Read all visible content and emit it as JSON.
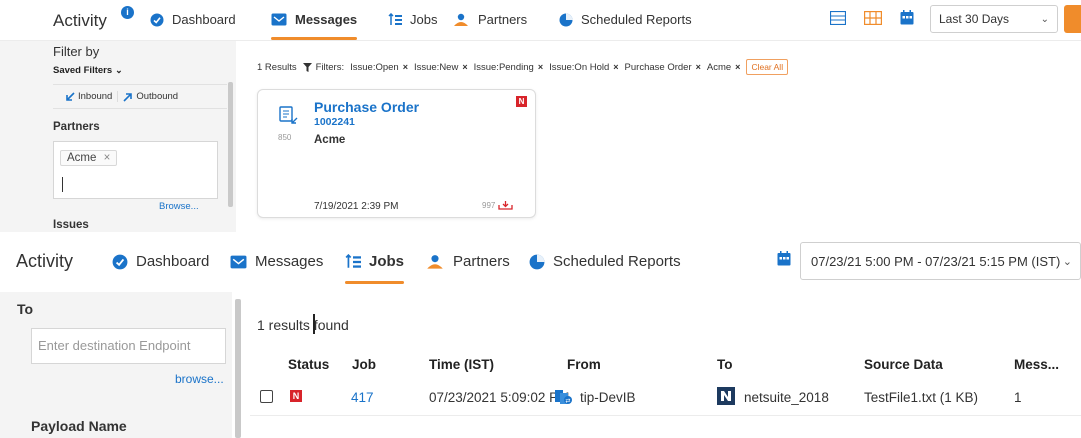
{
  "panel1": {
    "nav": {
      "title": "Activity",
      "title_badge": "i",
      "items": [
        {
          "label": "Dashboard",
          "icon": "dashboard-icon"
        },
        {
          "label": "Messages",
          "icon": "messages-icon",
          "active": true
        },
        {
          "label": "Jobs",
          "icon": "jobs-icon"
        },
        {
          "label": "Partners",
          "icon": "partners-icon"
        },
        {
          "label": "Scheduled Reports",
          "icon": "scheduled-reports-icon"
        }
      ],
      "date_range": "Last 30 Days",
      "accent": "#f08c2b"
    },
    "sidebar": {
      "filter_by": "Filter by",
      "saved_filters": "Saved Filters",
      "inbound": "Inbound",
      "outbound": "Outbound",
      "partners_heading": "Partners",
      "partner_tag": "Acme",
      "browse": "Browse...",
      "issues_heading": "Issues"
    },
    "results": {
      "count_text": "1 Results",
      "filters_label": "Filters:",
      "chips": [
        "Issue:Open",
        "Issue:New",
        "Issue:Pending",
        "Issue:On Hold",
        "Purchase Order",
        "Acme"
      ],
      "clear_all": "Clear All"
    },
    "card": {
      "title": "Purchase Order",
      "number": "1002241",
      "doc_code": "850",
      "partner": "Acme",
      "date": "7/19/2021 2:39 PM",
      "ack_code": "997",
      "badge": "N"
    }
  },
  "panel2": {
    "nav": {
      "title": "Activity",
      "items": [
        {
          "label": "Dashboard",
          "icon": "dashboard-icon"
        },
        {
          "label": "Messages",
          "icon": "messages-icon"
        },
        {
          "label": "Jobs",
          "icon": "jobs-icon",
          "active": true
        },
        {
          "label": "Partners",
          "icon": "partners-icon"
        },
        {
          "label": "Scheduled Reports",
          "icon": "scheduled-reports-icon"
        }
      ],
      "date_range": "07/23/21 5:00 PM - 07/23/21 5:15 PM (IST)"
    },
    "sidebar": {
      "to_heading": "To",
      "to_placeholder": "Enter destination Endpoint",
      "browse": "browse...",
      "payload_heading": "Payload Name"
    },
    "results_text": "1 results found",
    "table": {
      "columns": [
        "Status",
        "Job",
        "Time (IST)",
        "From",
        "To",
        "Source Data",
        "Mess..."
      ],
      "rows": [
        {
          "status": "N",
          "job": "417",
          "time": "07/23/2021 5:09:02 PM",
          "from": "tip-DevIB",
          "to": "netsuite_2018",
          "source": "TestFile1.txt (1 KB)",
          "messages": "1"
        }
      ]
    }
  }
}
